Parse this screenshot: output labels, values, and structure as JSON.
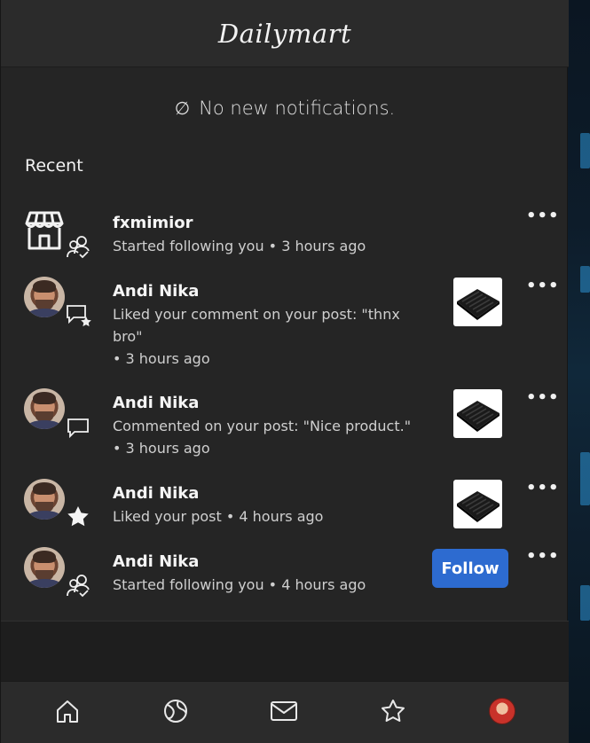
{
  "header": {
    "logo": "Dailymart"
  },
  "notice": {
    "icon": "null-icon",
    "symbol": "∅",
    "text": "No new notifications."
  },
  "section": {
    "title": "Recent"
  },
  "notifications": [
    {
      "name": "fxmimior",
      "desc": "Started following you • 3 hours ago",
      "type": "follow",
      "avatar": "store-icon"
    },
    {
      "name": "Andi Nika",
      "desc": "Liked your comment on your post: \"thnx bro\"",
      "time": "• 3 hours ago",
      "type": "comment-like",
      "has_thumb": true
    },
    {
      "name": "Andi Nika",
      "desc": "Commented on your post: \"Nice product.\"",
      "time": "• 3 hours ago",
      "type": "comment",
      "has_thumb": true
    },
    {
      "name": "Andi Nika",
      "desc": "Liked your post • 4 hours ago",
      "type": "like",
      "has_thumb": true
    },
    {
      "name": "Andi Nika",
      "desc": "Started following you • 4 hours ago",
      "type": "follow",
      "action": "Follow"
    }
  ],
  "more_label": "•••",
  "bottom_nav": [
    {
      "icon": "home-icon"
    },
    {
      "icon": "explore-icon"
    },
    {
      "icon": "mail-icon"
    },
    {
      "icon": "star-icon"
    },
    {
      "icon": "profile-avatar"
    }
  ],
  "colors": {
    "accent": "#2d6bd0",
    "background": "#252525",
    "header": "#2b2b2b"
  }
}
